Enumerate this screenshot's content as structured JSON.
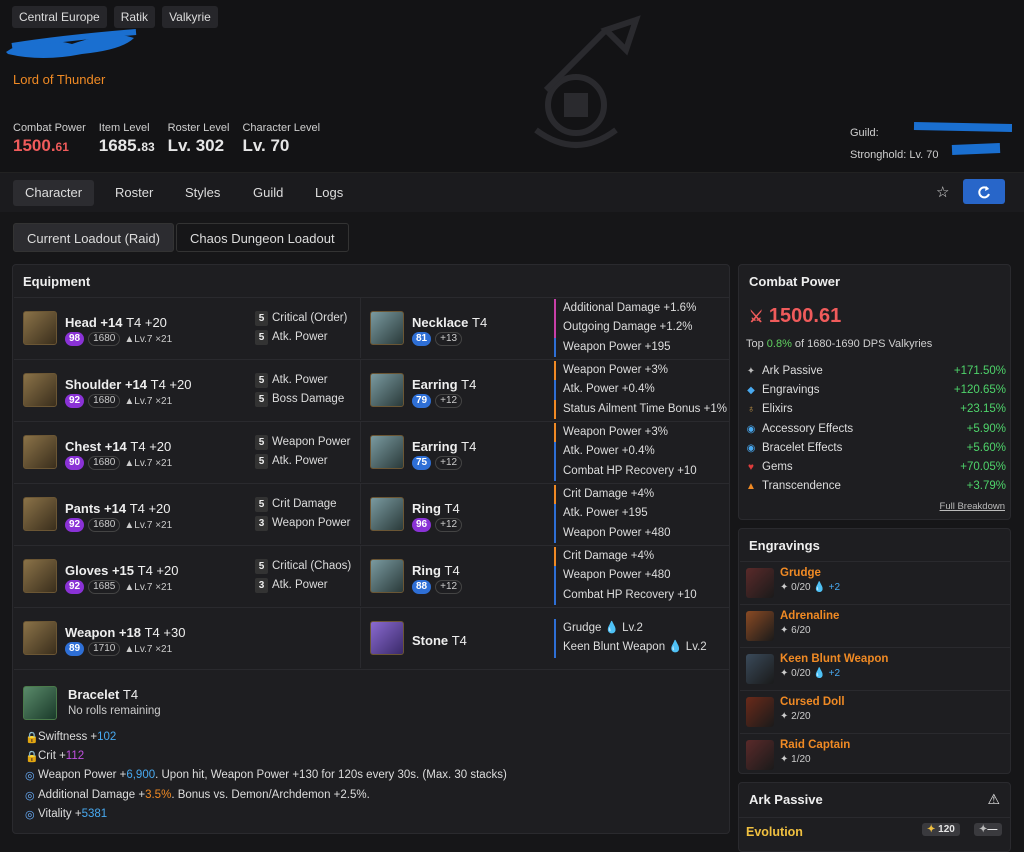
{
  "header": {
    "tags": [
      "Central Europe",
      "Ratik",
      "Valkyrie"
    ],
    "title": "Lord of Thunder",
    "stats": [
      {
        "label": "Combat Power",
        "main": "1500.",
        "dec": "61"
      },
      {
        "label": "Item Level",
        "main": "1685.",
        "dec": "83"
      },
      {
        "label": "Roster Level",
        "main": "Lv. 302",
        "dec": ""
      },
      {
        "label": "Character Level",
        "main": "Lv. 70",
        "dec": ""
      }
    ],
    "guild_label": "Guild:",
    "stronghold_label": "Stronghold:",
    "stronghold_value": "Lv. 70"
  },
  "nav": {
    "tabs": [
      "Character",
      "Roster",
      "Styles",
      "Guild",
      "Logs"
    ],
    "active": "Character"
  },
  "loadouts": [
    "Current Loadout (Raid)",
    "Chaos Dungeon Loadout"
  ],
  "equipment": {
    "title": "Equipment",
    "armor": [
      {
        "name": "Head +14",
        "tier": "T4 +20",
        "q": "98",
        "qc": "pu",
        "ilvl": "1680",
        "lvl": "Lv.7 ×21",
        "e": [
          [
            "5",
            "Critical (Order)"
          ],
          [
            "5",
            "Atk. Power"
          ]
        ]
      },
      {
        "name": "Shoulder +14",
        "tier": "T4 +20",
        "q": "92",
        "qc": "pu",
        "ilvl": "1680",
        "lvl": "Lv.7 ×21",
        "e": [
          [
            "5",
            "Atk. Power"
          ],
          [
            "5",
            "Boss Damage"
          ]
        ]
      },
      {
        "name": "Chest +14",
        "tier": "T4 +20",
        "q": "90",
        "qc": "pu",
        "ilvl": "1680",
        "lvl": "Lv.7 ×21",
        "e": [
          [
            "5",
            "Weapon Power"
          ],
          [
            "5",
            "Atk. Power"
          ]
        ]
      },
      {
        "name": "Pants +14",
        "tier": "T4 +20",
        "q": "92",
        "qc": "pu",
        "ilvl": "1680",
        "lvl": "Lv.7 ×21",
        "e": [
          [
            "5",
            "Crit Damage"
          ],
          [
            "3",
            "Weapon Power"
          ]
        ]
      },
      {
        "name": "Gloves +15",
        "tier": "T4 +20",
        "q": "92",
        "qc": "pu",
        "ilvl": "1685",
        "lvl": "Lv.7 ×21",
        "e": [
          [
            "5",
            "Critical (Chaos)"
          ],
          [
            "3",
            "Atk. Power"
          ]
        ]
      },
      {
        "name": "Weapon +18",
        "tier": "T4 +30",
        "q": "89",
        "qc": "bl",
        "ilvl": "1710",
        "lvl": "Lv.7 ×21",
        "e": []
      }
    ],
    "acc": [
      {
        "name": "Necklace",
        "tier": "T4",
        "q": "81",
        "qc": "bl",
        "ilvl": "+13",
        "fx": [
          [
            "bm",
            "Additional Damage +1.6%"
          ],
          [
            "bm",
            "Outgoing Damage +1.2%"
          ],
          [
            "bb",
            "Weapon Power +195"
          ]
        ]
      },
      {
        "name": "Earring",
        "tier": "T4",
        "q": "79",
        "qc": "bl",
        "ilvl": "+12",
        "fx": [
          [
            "bo",
            "Weapon Power +3%"
          ],
          [
            "bb",
            "Atk. Power +0.4%"
          ],
          [
            "bo",
            "Status Ailment Time Bonus +1%"
          ]
        ]
      },
      {
        "name": "Earring",
        "tier": "T4",
        "q": "75",
        "qc": "bl",
        "ilvl": "+12",
        "fx": [
          [
            "bo",
            "Weapon Power +3%"
          ],
          [
            "bb",
            "Atk. Power +0.4%"
          ],
          [
            "bb",
            "Combat HP Recovery +10"
          ]
        ]
      },
      {
        "name": "Ring",
        "tier": "T4",
        "q": "96",
        "qc": "pu",
        "ilvl": "+12",
        "fx": [
          [
            "bo",
            "Crit Damage +4%"
          ],
          [
            "bb",
            "Atk. Power +195"
          ],
          [
            "bb",
            "Weapon Power +480"
          ]
        ]
      },
      {
        "name": "Ring",
        "tier": "T4",
        "q": "88",
        "qc": "bl",
        "ilvl": "+12",
        "fx": [
          [
            "bo",
            "Crit Damage +4%"
          ],
          [
            "bb",
            "Weapon Power +480"
          ],
          [
            "bb",
            "Combat HP Recovery +10"
          ]
        ]
      },
      {
        "name": "Stone",
        "tier": "T4",
        "q": "",
        "qc": "",
        "ilvl": "",
        "fx": [
          [
            "bb",
            "Grudge 💧 Lv.2"
          ],
          [
            "bb",
            "Keen Blunt Weapon 💧 Lv.2"
          ]
        ]
      }
    ],
    "bracelet": {
      "name": "Bracelet",
      "tier": "T4",
      "sub": "No rolls remaining",
      "lines": [
        [
          "🔒",
          "Swiftness +",
          "102",
          "cy",
          ""
        ],
        [
          "🔒",
          "Crit +",
          "112",
          "mg",
          ""
        ],
        [
          "G",
          "Weapon Power +",
          "6,900",
          "cy",
          ". Upon hit, Weapon Power +130 for 120s every 30s. (Max. 30 stacks)"
        ],
        [
          "G",
          "Additional Damage +",
          "3.5%",
          "or",
          ". Bonus vs. Demon/Archdemon +2.5%."
        ],
        [
          "G",
          "Vitality +",
          "5381",
          "cy",
          ""
        ]
      ]
    }
  },
  "combat_power": {
    "title": "Combat Power",
    "value": "1500.61",
    "top_pre": "Top ",
    "top_pct": "0.8%",
    "top_post": " of 1680-1690 DPS Valkyries",
    "items": [
      [
        "✦",
        "Ark Passive",
        "+171.50%",
        "#bbb"
      ],
      [
        "◆",
        "Engravings",
        "+120.65%",
        "#48a9f0"
      ],
      [
        "♁",
        "Elixirs",
        "+23.15%",
        "#d4a24a"
      ],
      [
        "◉",
        "Accessory Effects",
        "+5.90%",
        "#48a9f0"
      ],
      [
        "◉",
        "Bracelet Effects",
        "+5.60%",
        "#48a9f0"
      ],
      [
        "♥",
        "Gems",
        "+70.05%",
        "#e03c3c"
      ],
      [
        "▲",
        "Transcendence",
        "+3.79%",
        "#f08a24"
      ]
    ],
    "breakdown": "Full Breakdown"
  },
  "engravings": {
    "title": "Engravings",
    "items": [
      {
        "name": "Grudge",
        "val": "0/20",
        "stone": "+2",
        "bg": "#5a2a2a"
      },
      {
        "name": "Adrenaline",
        "val": "6/20",
        "stone": "",
        "bg": "#8a4a24"
      },
      {
        "name": "Keen Blunt Weapon",
        "val": "0/20",
        "stone": "+2",
        "bg": "#3a4a5a"
      },
      {
        "name": "Cursed Doll",
        "val": "2/20",
        "stone": "",
        "bg": "#6a2a1a"
      },
      {
        "name": "Raid Captain",
        "val": "1/20",
        "stone": "",
        "bg": "#5a2a2a"
      }
    ]
  },
  "ark_passive": {
    "title": "Ark Passive",
    "evolution": "Evolution",
    "points": "120",
    "extra": "—"
  }
}
